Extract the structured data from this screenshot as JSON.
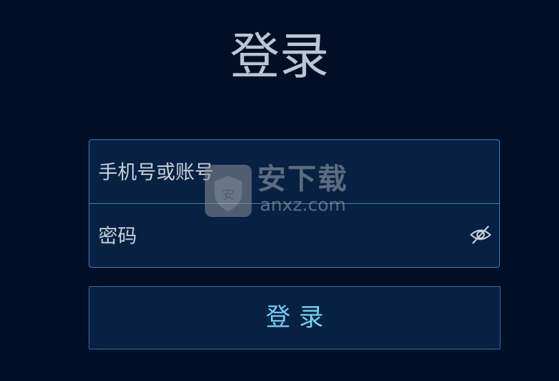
{
  "page": {
    "title": "登录"
  },
  "form": {
    "account_placeholder": "手机号或账号",
    "password_placeholder": "密码",
    "password_toggle_icon": "eye-off-icon"
  },
  "actions": {
    "login_label": "登录"
  },
  "watermark": {
    "brand_text": "安下载",
    "site_text": "anxz.com",
    "badge_char": "安"
  },
  "colors": {
    "background": "#000f26",
    "field_border": "#3f83bd",
    "field_background": "#082143",
    "button_text": "#6fcff2",
    "title_text": "#b9c6d4"
  }
}
